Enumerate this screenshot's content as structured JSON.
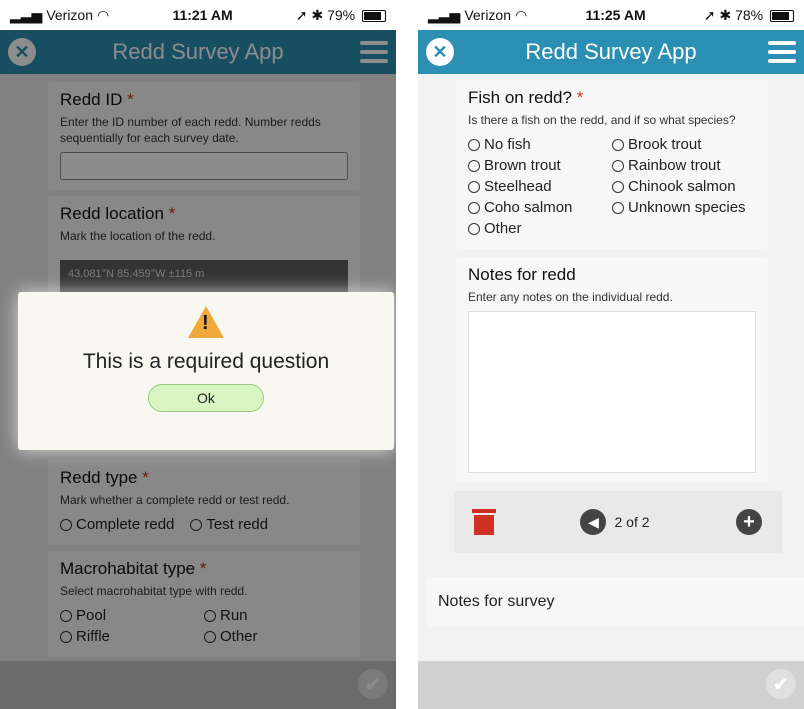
{
  "left": {
    "status": {
      "carrier": "Verizon",
      "time": "11:21 AM",
      "battery": "79%"
    },
    "app_title": "Redd Survey App",
    "redd_id": {
      "title": "Redd ID",
      "hint": "Enter the ID number of each redd. Number redds sequentially for each survey date."
    },
    "redd_location": {
      "title": "Redd location",
      "hint": "Mark the location of the redd.",
      "map_text": "43.081°N 85.459°W  ±115 m"
    },
    "dialog": {
      "message": "This is a required question",
      "ok": "Ok"
    },
    "redd_type": {
      "title": "Redd type",
      "hint": "Mark whether a complete redd or test redd.",
      "options": [
        "Complete redd",
        "Test redd"
      ]
    },
    "macro": {
      "title": "Macrohabitat type",
      "hint": "Select macrohabitat type with redd.",
      "options": [
        "Pool",
        "Run",
        "Riffle",
        "Other"
      ]
    }
  },
  "right": {
    "status": {
      "carrier": "Verizon",
      "time": "11:25 AM",
      "battery": "78%"
    },
    "app_title": "Redd Survey App",
    "fish": {
      "title": "Fish on redd?",
      "hint": "Is there a fish on the redd, and if so what species?",
      "options": [
        "No fish",
        "Brook trout",
        "Brown trout",
        "Rainbow trout",
        "Steelhead",
        "Chinook salmon",
        "Coho salmon",
        "Unknown species",
        "Other"
      ]
    },
    "notes": {
      "title": "Notes for redd",
      "hint": "Enter any notes on the individual redd."
    },
    "pager": {
      "label": "2 of 2"
    },
    "survey_notes": "Notes for survey"
  },
  "required_mark": "*",
  "colors": {
    "appbar": "#2a8fb3",
    "required": "#d0301f",
    "ok_button": "#d9f6c2",
    "warning": "#f2a93b"
  }
}
